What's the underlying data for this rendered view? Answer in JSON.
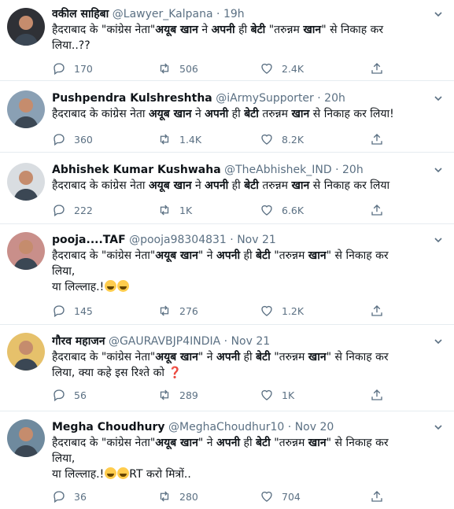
{
  "tweets": [
    {
      "name": "वकील साहिबा",
      "handle": "@Lawyer_Kalpana",
      "dot": "·",
      "time": "19h",
      "lines": [
        [
          {
            "t": "हैदराबाद के \"कांग्रेस नेता\"",
            "b": false
          },
          {
            "t": "अयूब खान",
            "b": true
          },
          {
            "t": " ने ",
            "b": false
          },
          {
            "t": "अपनी",
            "b": true
          },
          {
            "t": " ही ",
            "b": false
          },
          {
            "t": "बेटी",
            "b": true
          },
          {
            "t": " \"तरुन्नम ",
            "b": false
          },
          {
            "t": "खान",
            "b": true
          },
          {
            "t": "\" से निकाह कर",
            "b": false
          }
        ],
        [
          {
            "t": "लिया..??",
            "b": false
          }
        ]
      ],
      "replies": "170",
      "retweets": "506",
      "likes": "2.4K",
      "avatar_bg": "#2f3136"
    },
    {
      "name": "Pushpendra Kulshreshtha",
      "handle": "@iArmySupporter",
      "dot": "·",
      "time": "20h",
      "lines": [
        [
          {
            "t": "हैदराबाद के कांग्रेस नेता ",
            "b": false
          },
          {
            "t": "अयूब खान",
            "b": true
          },
          {
            "t": " ने ",
            "b": false
          },
          {
            "t": "अपनी",
            "b": true
          },
          {
            "t": " ही ",
            "b": false
          },
          {
            "t": "बेटी",
            "b": true
          },
          {
            "t": " तरुन्नम ",
            "b": false
          },
          {
            "t": "खान",
            "b": true
          },
          {
            "t": " से निकाह कर लिया!",
            "b": false
          }
        ]
      ],
      "replies": "360",
      "retweets": "1.4K",
      "likes": "8.2K",
      "avatar_bg": "#8aa0b4"
    },
    {
      "name": "Abhishek Kumar Kushwaha",
      "handle": "@TheAbhishek_IND",
      "dot": "·",
      "time": "20h",
      "lines": [
        [
          {
            "t": "हैदराबाद के कांग्रेस नेता ",
            "b": false
          },
          {
            "t": "अयूब खान",
            "b": true
          },
          {
            "t": " ने ",
            "b": false
          },
          {
            "t": "अपनी",
            "b": true
          },
          {
            "t": " ही ",
            "b": false
          },
          {
            "t": "बेटी",
            "b": true
          },
          {
            "t": " तरुन्नम ",
            "b": false
          },
          {
            "t": "खान",
            "b": true
          },
          {
            "t": " से निकाह कर लिया",
            "b": false
          }
        ]
      ],
      "replies": "222",
      "retweets": "1K",
      "likes": "6.6K",
      "avatar_bg": "#d9dde1"
    },
    {
      "name": "pooja....TAF",
      "handle": "@pooja98304831",
      "dot": "·",
      "time": "Nov 21",
      "lines": [
        [
          {
            "t": "हैदराबाद के \"कांग्रेस नेता\"",
            "b": false
          },
          {
            "t": "अयूब खान",
            "b": true
          },
          {
            "t": "\" ने ",
            "b": false
          },
          {
            "t": "अपनी",
            "b": true
          },
          {
            "t": " ही ",
            "b": false
          },
          {
            "t": "बेटी",
            "b": true
          },
          {
            "t": " \"तरुन्नम ",
            "b": false
          },
          {
            "t": "खान",
            "b": true
          },
          {
            "t": "\" से निकाह कर",
            "b": false
          }
        ],
        [
          {
            "t": "लिया,",
            "b": false
          }
        ],
        [
          {
            "t": "या लिल्लाह.!",
            "b": false
          },
          {
            "emoji": "rofl-emoji"
          },
          {
            "emoji": "rofl-emoji"
          }
        ]
      ],
      "replies": "145",
      "retweets": "276",
      "likes": "1.2K",
      "avatar_bg": "#c98f8a"
    },
    {
      "name": "गौरव महाजन",
      "handle": "@GAURAVBJP4INDIA",
      "dot": "·",
      "time": "Nov 21",
      "lines": [
        [
          {
            "t": "हैदराबाद के \"कांग्रेस नेता\"",
            "b": false
          },
          {
            "t": "अयूब खान",
            "b": true
          },
          {
            "t": "\" ने ",
            "b": false
          },
          {
            "t": "अपनी",
            "b": true
          },
          {
            "t": " ही ",
            "b": false
          },
          {
            "t": "बेटी",
            "b": true
          },
          {
            "t": " \"तरुन्नम ",
            "b": false
          },
          {
            "t": "खान",
            "b": true
          },
          {
            "t": "\" से निकाह कर",
            "b": false
          }
        ],
        [
          {
            "t": "लिया, क्या कहे इस रिश्ते को ",
            "b": false
          },
          {
            "q": "❓"
          }
        ]
      ],
      "replies": "56",
      "retweets": "289",
      "likes": "1K",
      "avatar_bg": "#e6c16b"
    },
    {
      "name": "Megha Choudhury",
      "handle": "@MeghaChoudhur10",
      "dot": "·",
      "time": "Nov 20",
      "lines": [
        [
          {
            "t": "हैदराबाद के \"कांग्रेस नेता\"",
            "b": false
          },
          {
            "t": "अयूब खान",
            "b": true
          },
          {
            "t": "\" ने ",
            "b": false
          },
          {
            "t": "अपनी",
            "b": true
          },
          {
            "t": " ही ",
            "b": false
          },
          {
            "t": "बेटी",
            "b": true
          },
          {
            "t": " \"तरुन्नम ",
            "b": false
          },
          {
            "t": "खान",
            "b": true
          },
          {
            "t": "\" से निकाह कर",
            "b": false
          }
        ],
        [
          {
            "t": "लिया,",
            "b": false
          }
        ],
        [
          {
            "t": "या लिल्लाह.!",
            "b": false
          },
          {
            "emoji": "rofl-emoji"
          },
          {
            "emoji": "rofl-emoji"
          },
          {
            "t": "RT करो मित्रों..",
            "b": false
          }
        ]
      ],
      "replies": "36",
      "retweets": "280",
      "likes": "704",
      "avatar_bg": "#6f8a9e"
    }
  ],
  "colors": {
    "text": "#0f1419",
    "muted": "#5b7083",
    "divider": "#e6ecf0"
  },
  "icons": [
    "reply-icon",
    "retweet-icon",
    "like-icon",
    "share-icon",
    "chevron-down-icon"
  ]
}
